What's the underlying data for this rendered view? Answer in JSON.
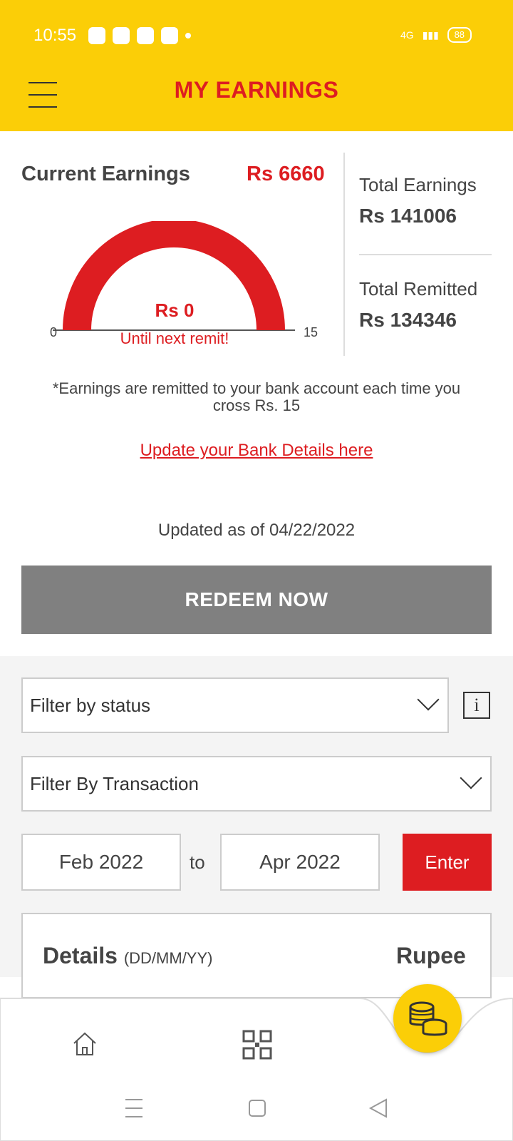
{
  "status_bar": {
    "time": "10:55",
    "battery": "88",
    "network": "4G"
  },
  "header": {
    "title": "MY EARNINGS"
  },
  "earnings": {
    "current_label": "Current Earnings",
    "current_value": "Rs 6660",
    "total_label": "Total Earnings",
    "total_value": "Rs 141006",
    "remitted_label": "Total Remitted",
    "remitted_value": "Rs 134346",
    "gauge": {
      "min": "0",
      "max": "15",
      "value": "Rs 0",
      "caption": "Until next remit!",
      "fill_fraction": 1.0,
      "color": "#DD1D21"
    },
    "note": "*Earnings are remitted to your bank account each time you cross Rs. 15",
    "bank_link": "Update your Bank Details here",
    "updated": "Updated as of 04/22/2022",
    "redeem_label": "REDEEM NOW"
  },
  "filters": {
    "status_placeholder": "Filter by status",
    "info_icon": "i",
    "transaction_placeholder": "Filter By Transaction",
    "from": "Feb 2022",
    "to_label": "to",
    "to": "Apr 2022",
    "enter_label": "Enter"
  },
  "details": {
    "title": "Details",
    "format": "(DD/MM/YY)",
    "amount_header": "Rupee"
  },
  "nav": {
    "items": [
      "home-icon",
      "qr-icon",
      "coins-icon"
    ]
  },
  "colors": {
    "brand_yellow": "#FBCE07",
    "brand_red": "#DD1D21",
    "button_grey": "#808080"
  }
}
